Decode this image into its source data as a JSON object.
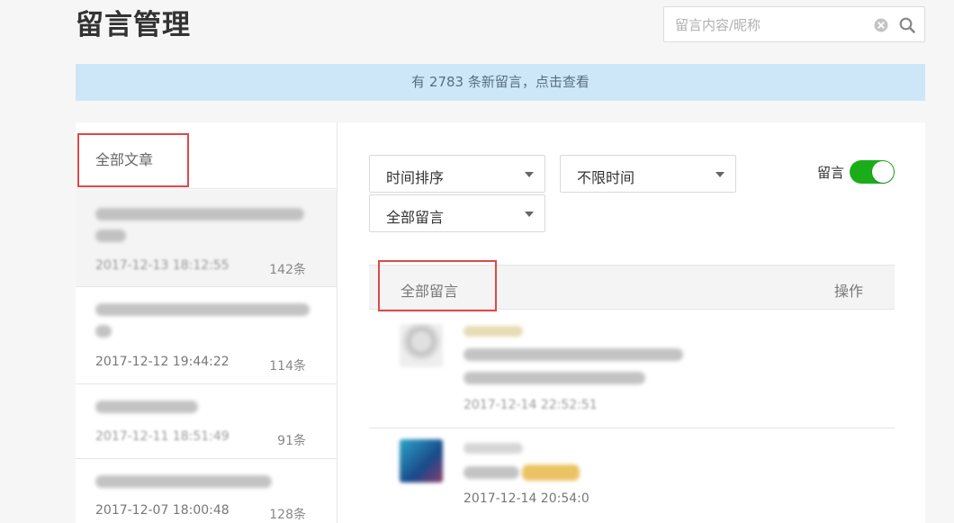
{
  "header": {
    "title": "留言管理",
    "search_placeholder": "留言内容/昵称"
  },
  "banner": {
    "text": "有 2783 条新留言，点击查看"
  },
  "sidebar": {
    "heading": "全部文章",
    "articles": [
      {
        "date": "2017-12-13 18:12:55",
        "count": "142条"
      },
      {
        "date": "2017-12-12 19:44:22",
        "count": "114条"
      },
      {
        "date": "2017-12-11 18:51:49",
        "count": "91条"
      },
      {
        "date": "2017-12-07 18:00:48",
        "count": "128条"
      }
    ]
  },
  "filters": {
    "sort": "时间排序",
    "time": "不限时间",
    "type": "全部留言"
  },
  "toggle": {
    "label": "留言",
    "state": "on",
    "color": "#1aad19"
  },
  "table": {
    "col_comments": "全部留言",
    "col_actions": "操作"
  },
  "comments": [
    {
      "date": "2017-12-14 22:52:51"
    },
    {
      "date": "2017-12-14 20:54:0"
    }
  ],
  "colors": {
    "banner_bg": "#cde7f9",
    "highlight_box": "#e04848"
  }
}
